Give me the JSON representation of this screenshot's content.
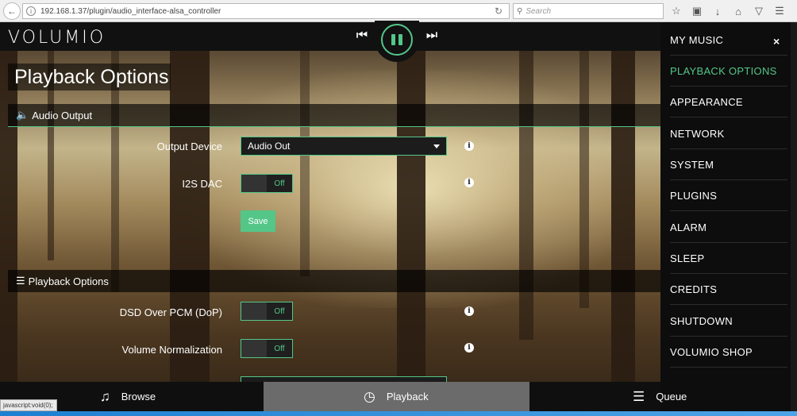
{
  "browser": {
    "url": "192.168.1.37/plugin/audio_interface-alsa_controller",
    "search_placeholder": "Search",
    "status_text": "javascript:void(0);"
  },
  "app": {
    "logo": "VOLUMIO",
    "page_title": "Playback Options",
    "accent_color": "#54c688"
  },
  "player": {
    "prev_icon": "skip-previous-icon",
    "pause_icon": "pause-icon",
    "next_icon": "skip-next-icon"
  },
  "audio_output": {
    "header": "Audio Output",
    "output_device_label": "Output Device",
    "output_device_value": "Audio Out",
    "i2s_label": "I2S DAC",
    "i2s_state": "Off",
    "save_label": "Save"
  },
  "playback_options": {
    "header": "Playback Options",
    "dsd_label": "DSD Over PCM (DoP)",
    "dsd_state": "Off",
    "volnorm_label": "Volume Normalization",
    "volnorm_state": "Off"
  },
  "menu": {
    "items": [
      {
        "label": "MY MUSIC"
      },
      {
        "label": "PLAYBACK OPTIONS"
      },
      {
        "label": "APPEARANCE"
      },
      {
        "label": "NETWORK"
      },
      {
        "label": "SYSTEM"
      },
      {
        "label": "PLUGINS"
      },
      {
        "label": "ALARM"
      },
      {
        "label": "SLEEP"
      },
      {
        "label": "CREDITS"
      },
      {
        "label": "SHUTDOWN"
      },
      {
        "label": "VOLUMIO SHOP"
      }
    ],
    "close": "×"
  },
  "footer": {
    "browse": "Browse",
    "playback": "Playback",
    "queue": "Queue"
  }
}
